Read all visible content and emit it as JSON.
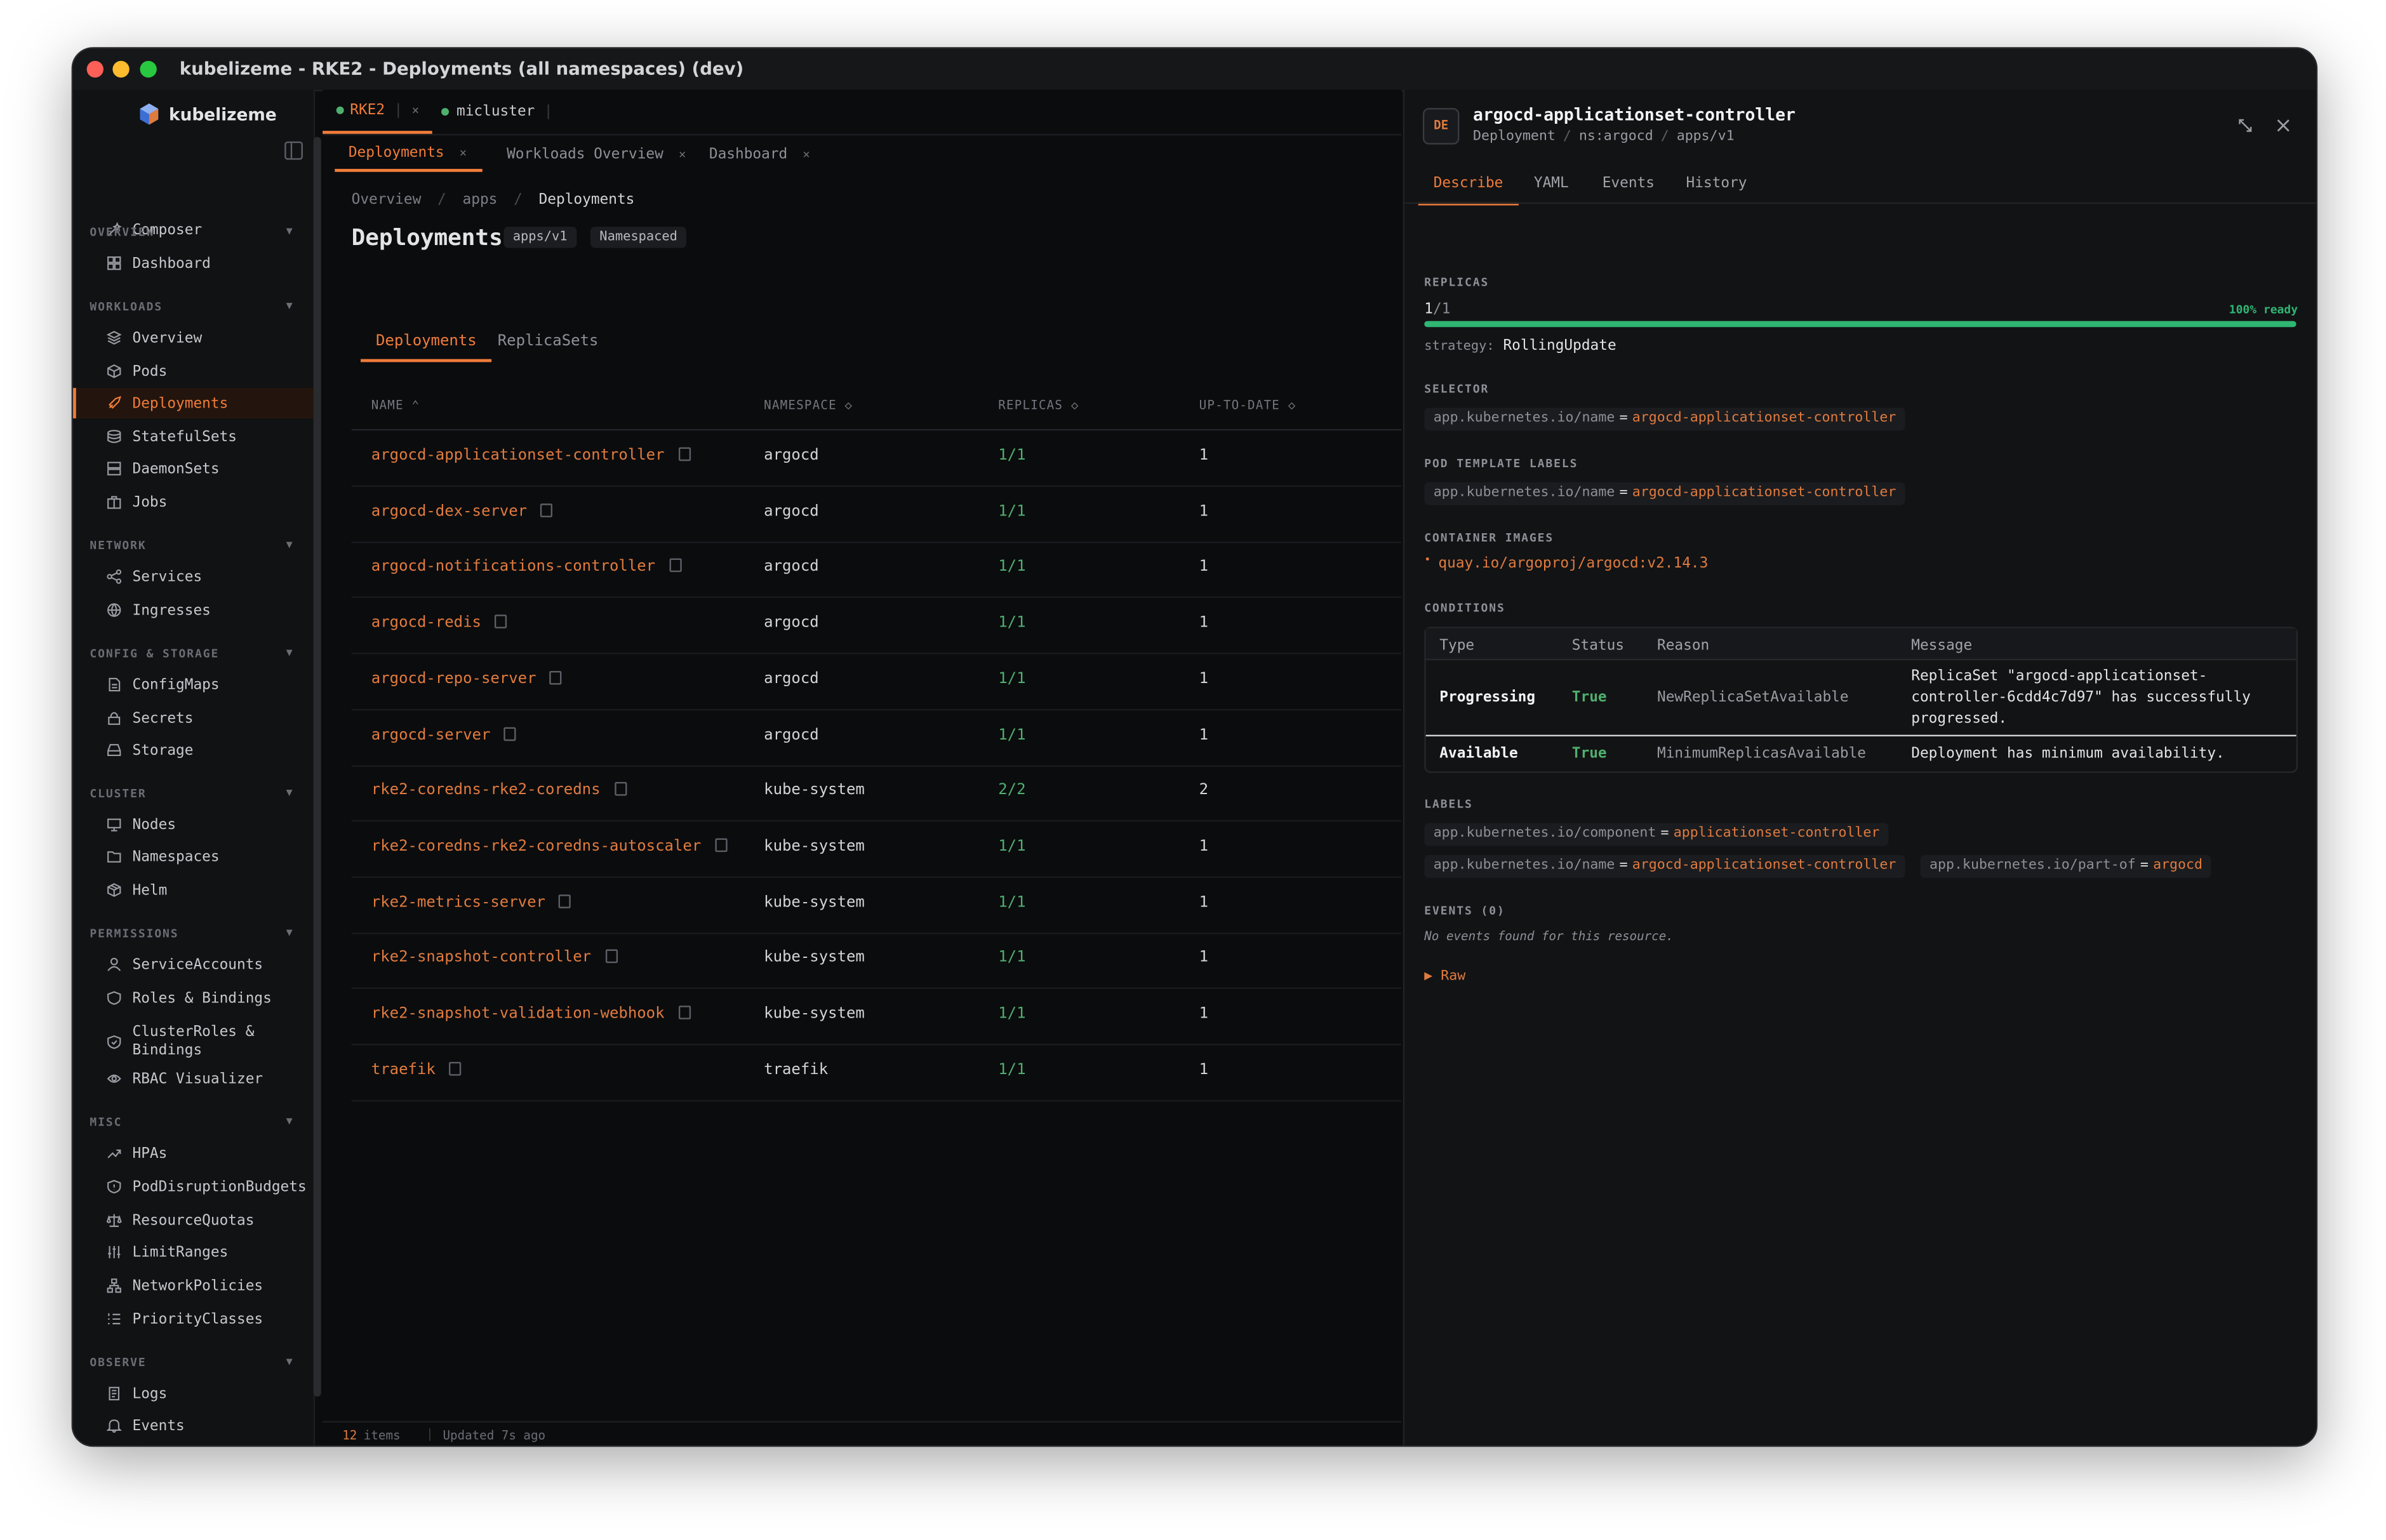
{
  "window": {
    "title": "kubelizeme - RKE2 - Deployments (all namespaces) (dev)",
    "lights": [
      "#fe5f57",
      "#febc2e",
      "#28c840"
    ]
  },
  "app": {
    "name": "kubelizeme"
  },
  "sidebar": {
    "composer": "Composer",
    "sections": [
      {
        "label": "OVERVIEW",
        "items": [
          {
            "label": "Dashboard",
            "icon": "grid-icon"
          }
        ]
      },
      {
        "label": "WORKLOADS",
        "items": [
          {
            "label": "Overview",
            "icon": "layers-icon"
          },
          {
            "label": "Pods",
            "icon": "cube-icon"
          },
          {
            "label": "Deployments",
            "icon": "rocket-icon",
            "active": true
          },
          {
            "label": "StatefulSets",
            "icon": "database-icon"
          },
          {
            "label": "DaemonSets",
            "icon": "server-icon"
          },
          {
            "label": "Jobs",
            "icon": "briefcase-icon"
          }
        ]
      },
      {
        "label": "NETWORK",
        "items": [
          {
            "label": "Services",
            "icon": "share-icon"
          },
          {
            "label": "Ingresses",
            "icon": "globe-icon"
          }
        ]
      },
      {
        "label": "CONFIG & STORAGE",
        "items": [
          {
            "label": "ConfigMaps",
            "icon": "file-icon"
          },
          {
            "label": "Secrets",
            "icon": "lock-icon"
          },
          {
            "label": "Storage",
            "icon": "hard-drive-icon"
          }
        ]
      },
      {
        "label": "CLUSTER",
        "items": [
          {
            "label": "Nodes",
            "icon": "monitor-icon"
          },
          {
            "label": "Namespaces",
            "icon": "folder-icon"
          },
          {
            "label": "Helm",
            "icon": "package-icon"
          }
        ]
      },
      {
        "label": "PERMISSIONS",
        "items": [
          {
            "label": "ServiceAccounts",
            "icon": "user-icon"
          },
          {
            "label": "Roles & Bindings",
            "icon": "shield-icon"
          },
          {
            "label": "ClusterRoles & Bindings",
            "icon": "shield-check-icon"
          },
          {
            "label": "RBAC Visualizer",
            "icon": "eye-icon"
          }
        ]
      },
      {
        "label": "MISC",
        "items": [
          {
            "label": "HPAs",
            "icon": "trending-up-icon"
          },
          {
            "label": "PodDisruptionBudgets",
            "icon": "shield-alert-icon"
          },
          {
            "label": "ResourceQuotas",
            "icon": "scale-icon"
          },
          {
            "label": "LimitRanges",
            "icon": "sliders-icon"
          },
          {
            "label": "NetworkPolicies",
            "icon": "network-icon"
          },
          {
            "label": "PriorityClasses",
            "icon": "list-ordered-icon"
          }
        ]
      },
      {
        "label": "OBSERVE",
        "items": [
          {
            "label": "Logs",
            "icon": "scroll-icon"
          },
          {
            "label": "Events",
            "icon": "bell-icon"
          }
        ]
      }
    ]
  },
  "cluster_tabs": [
    {
      "label": "RKE2",
      "close": "×"
    },
    {
      "label": "micluster"
    }
  ],
  "page_tabs": [
    {
      "label": "Deployments",
      "close": "×"
    },
    {
      "label": "Workloads Overview",
      "close": "×"
    },
    {
      "label": "Dashboard",
      "close": "×"
    }
  ],
  "breadcrumb": {
    "a": "Overview",
    "sep": "/",
    "b": "apps",
    "c": "Deployments"
  },
  "page": {
    "title": "Deployments",
    "api_pill": "apps/v1",
    "scope_pill": "Namespaced",
    "subtabs": [
      "Deployments",
      "ReplicaSets"
    ]
  },
  "table": {
    "columns": [
      "NAME ⌃",
      "NAMESPACE ◇",
      "REPLICAS ◇",
      "UP-TO-DATE ◇"
    ],
    "rows": [
      {
        "name": "argocd-applicationset-controller",
        "ns": "argocd",
        "replicas": "1/1",
        "uptodate": "1"
      },
      {
        "name": "argocd-dex-server",
        "ns": "argocd",
        "replicas": "1/1",
        "uptodate": "1"
      },
      {
        "name": "argocd-notifications-controller",
        "ns": "argocd",
        "replicas": "1/1",
        "uptodate": "1"
      },
      {
        "name": "argocd-redis",
        "ns": "argocd",
        "replicas": "1/1",
        "uptodate": "1"
      },
      {
        "name": "argocd-repo-server",
        "ns": "argocd",
        "replicas": "1/1",
        "uptodate": "1"
      },
      {
        "name": "argocd-server",
        "ns": "argocd",
        "replicas": "1/1",
        "uptodate": "1"
      },
      {
        "name": "rke2-coredns-rke2-coredns",
        "ns": "kube-system",
        "replicas": "2/2",
        "uptodate": "2"
      },
      {
        "name": "rke2-coredns-rke2-coredns-autoscaler",
        "ns": "kube-system",
        "replicas": "1/1",
        "uptodate": "1"
      },
      {
        "name": "rke2-metrics-server",
        "ns": "kube-system",
        "replicas": "1/1",
        "uptodate": "1"
      },
      {
        "name": "rke2-snapshot-controller",
        "ns": "kube-system",
        "replicas": "1/1",
        "uptodate": "1"
      },
      {
        "name": "rke2-snapshot-validation-webhook",
        "ns": "kube-system",
        "replicas": "1/1",
        "uptodate": "1"
      },
      {
        "name": "traefik",
        "ns": "traefik",
        "replicas": "1/1",
        "uptodate": "1"
      }
    ]
  },
  "statusbar": {
    "count": "12",
    "items": "items",
    "updated": "Updated 7s ago"
  },
  "panel": {
    "badge": "DE",
    "title": "argocd-applicationset-controller",
    "kind": "Deployment",
    "ns": "ns:argocd",
    "api": "apps/v1",
    "sep": "/",
    "tabs": [
      "Describe",
      "YAML",
      "Events",
      "History"
    ],
    "replicas_label": "REPLICAS",
    "replicas_current": "1",
    "replicas_total": "/1",
    "ready_text": "100% ready",
    "ready_fraction": 1.0,
    "strategy_label": "strategy:",
    "strategy": "RollingUpdate",
    "selector_label": "SELECTOR",
    "selector": {
      "key": "app.kubernetes.io/name",
      "eq": "=",
      "value": "argocd-applicationset-controller"
    },
    "pod_labels_label": "POD TEMPLATE LABELS",
    "pod_label": {
      "key": "app.kubernetes.io/name",
      "eq": "=",
      "value": "argocd-applicationset-controller"
    },
    "images_label": "CONTAINER IMAGES",
    "image": "quay.io/argoproj/argocd:v2.14.3",
    "conditions_label": "CONDITIONS",
    "conditions_head": [
      "Type",
      "Status",
      "Reason",
      "Message"
    ],
    "conditions": [
      {
        "type": "Progressing",
        "status": "True",
        "reason": "NewReplicaSetAvailable",
        "msg1": "ReplicaSet \"argocd-applicationset-",
        "msg2": "controller-6cdd4c7d97\" has successfully",
        "msg3": "progressed."
      },
      {
        "type": "Available",
        "status": "True",
        "reason": "MinimumReplicasAvailable",
        "msg": "Deployment has minimum availability."
      }
    ],
    "labels_label": "LABELS",
    "labels": [
      {
        "key": "app.kubernetes.io/component",
        "eq": "=",
        "value": "applicationset-controller"
      },
      {
        "key": "app.kubernetes.io/name",
        "eq": "=",
        "value": "argocd-applicationset-controller"
      },
      {
        "key": "app.kubernetes.io/part-of",
        "eq": "=",
        "value": "argocd"
      }
    ],
    "events_label": "EVENTS (0)",
    "events_empty": "No events found for this resource.",
    "raw": "▶ Raw"
  },
  "colors": {
    "accent": "#f07c3a",
    "ok": "#4fb06e",
    "progress": "#2fb673"
  }
}
